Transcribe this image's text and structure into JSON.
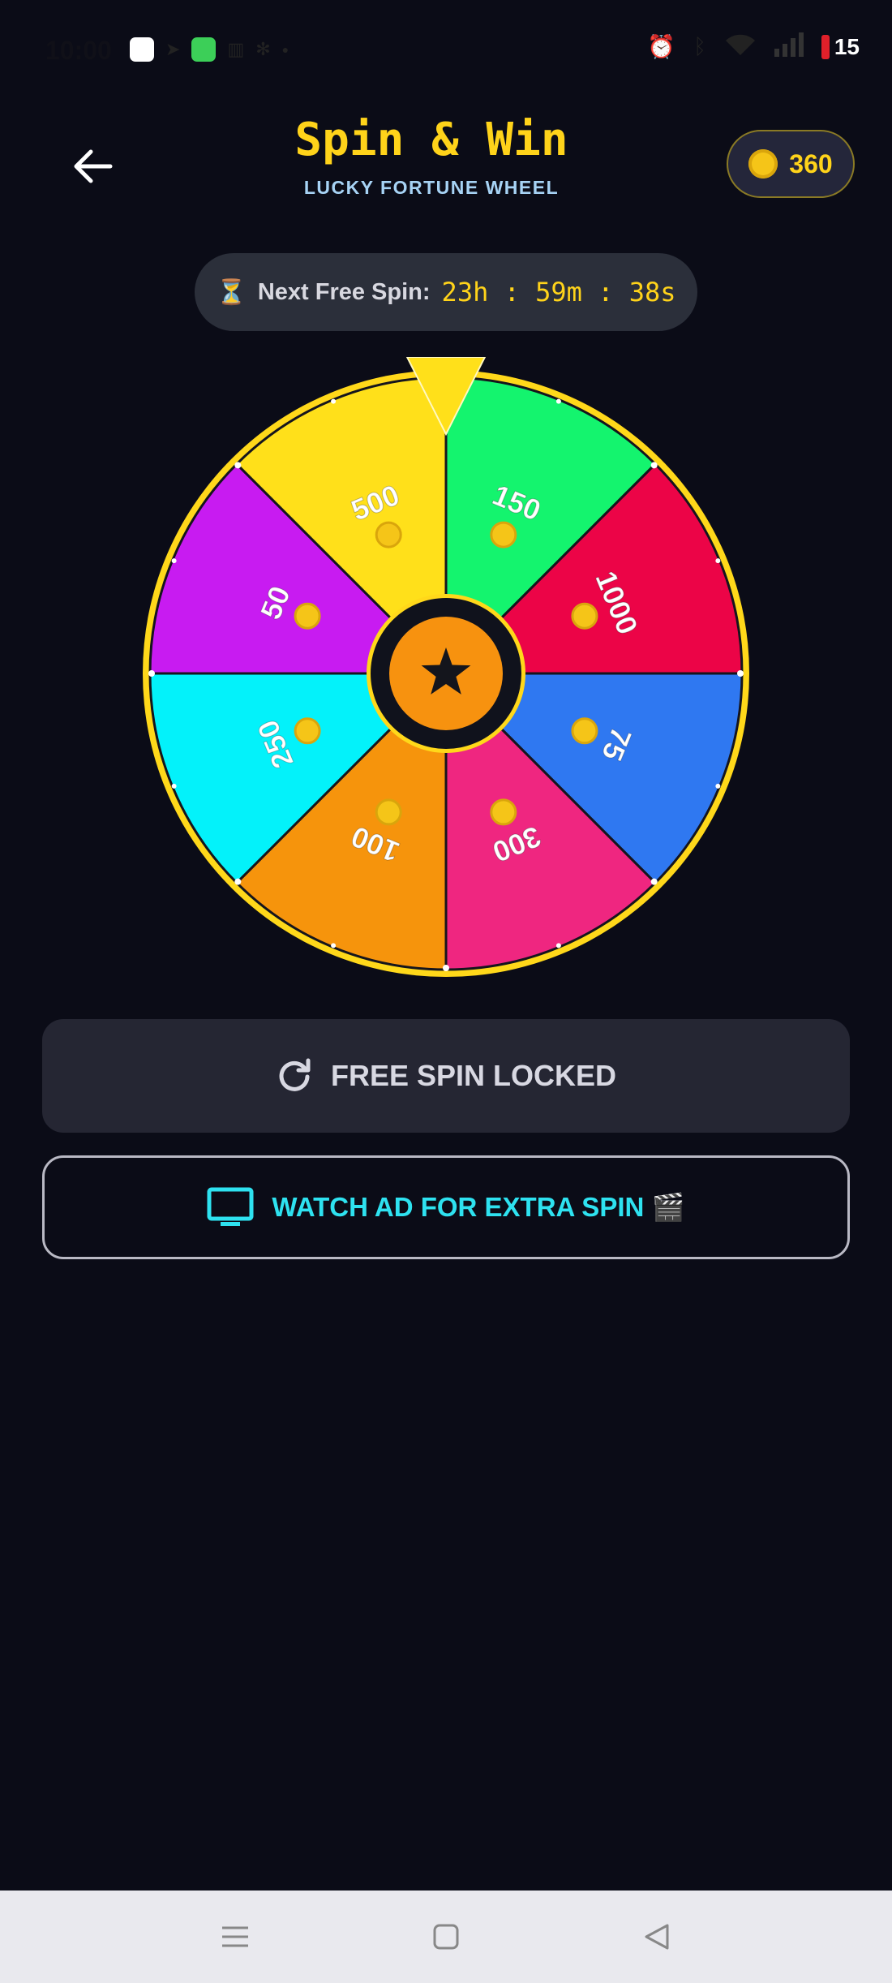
{
  "status_bar": {
    "time": "10:00",
    "battery": "15"
  },
  "header": {
    "title": "Spin & Win",
    "subtitle": "LUCKY FORTUNE WHEEL",
    "coins": "360"
  },
  "timer": {
    "label": "Next Free Spin:",
    "value": "23h : 59m : 38s",
    "icon": "hourglass-icon"
  },
  "wheel": {
    "segments": [
      {
        "label": "150",
        "color": "#14f46e"
      },
      {
        "label": "1000",
        "color": "#ec0447"
      },
      {
        "label": "75",
        "color": "#2f78f1"
      },
      {
        "label": "300",
        "color": "#ef2680"
      },
      {
        "label": "100",
        "color": "#f6940c"
      },
      {
        "label": "250",
        "color": "#03f2fa"
      },
      {
        "label": "50",
        "color": "#c81bf1"
      },
      {
        "label": "500",
        "color": "#ffe01a"
      }
    ],
    "rim_color": "#ffd81a",
    "pointer_color": "#ffe01a",
    "hub_color": "#f7920f"
  },
  "buttons": {
    "free_spin_label": "FREE SPIN LOCKED",
    "watch_ad_label": "WATCH AD FOR EXTRA SPIN 🎬"
  },
  "colors": {
    "background": "#0b0c17",
    "accent_yellow": "#ffd31a",
    "accent_cyan": "#2ee2f0"
  }
}
